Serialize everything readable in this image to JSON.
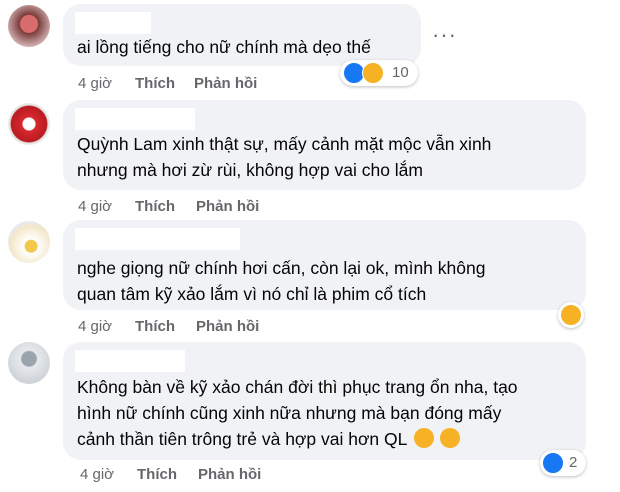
{
  "actions": {
    "like": "Thích",
    "reply": "Phản hồi"
  },
  "comments": [
    {
      "text_lines": [
        "ai lồng tiếng cho nữ chính mà dẹo thế"
      ],
      "time": "4 giờ",
      "reaction_count": "10"
    },
    {
      "text_lines": [
        "Quỳnh Lam xinh thật sự, mấy cảnh mặt mộc vẫn xinh",
        "nhưng mà hơi zừ rùi, không hợp vai cho lắm"
      ],
      "time": "4 giờ"
    },
    {
      "text_lines": [
        "nghe giọng nữ chính hơi cấn, còn lại ok, mình không",
        "quan tâm kỹ xảo lắm vì nó chỉ là phim cổ tích"
      ],
      "time": "4 giờ"
    },
    {
      "text_lines": [
        "Không bàn về kỹ xảo chán đời thì phục trang ổn nha, tạo",
        "hình nữ chính cũng xinh nữa nhưng mà bạn đóng mấy",
        "cảnh thần tiên trông trẻ và hợp vai hơn QL"
      ],
      "time": "4 giờ",
      "reaction_count": "2"
    }
  ],
  "icons": {
    "more": "more-options-icon",
    "like": "like-reaction-icon",
    "haha": "haha-reaction-icon"
  },
  "colors": {
    "bubble": "#f0f2f5",
    "meta": "#65676b",
    "like": "#1877f2",
    "haha": "#f7b125"
  }
}
